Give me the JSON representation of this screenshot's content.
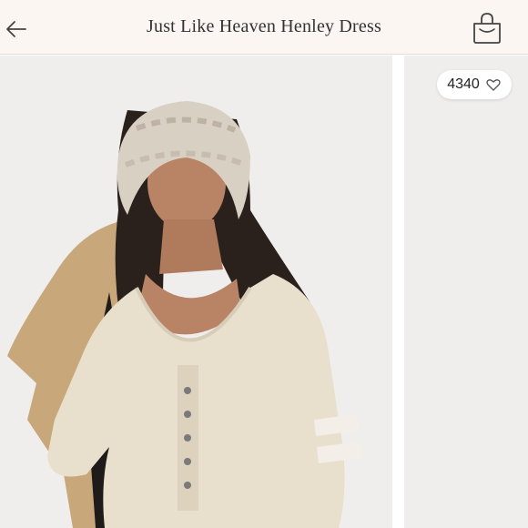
{
  "header": {
    "title": "Just Like Heaven Henley Dress",
    "back_icon": "arrow-left-icon",
    "cart_icon": "shopping-bag-icon"
  },
  "product": {
    "likes_count": "4340",
    "like_icon": "heart-outline-icon"
  },
  "colors": {
    "header_bg": "#fbf6f1",
    "photo_bg": "#efeeec",
    "dress": "#e8dfcd",
    "coat": "#c8a87a"
  }
}
